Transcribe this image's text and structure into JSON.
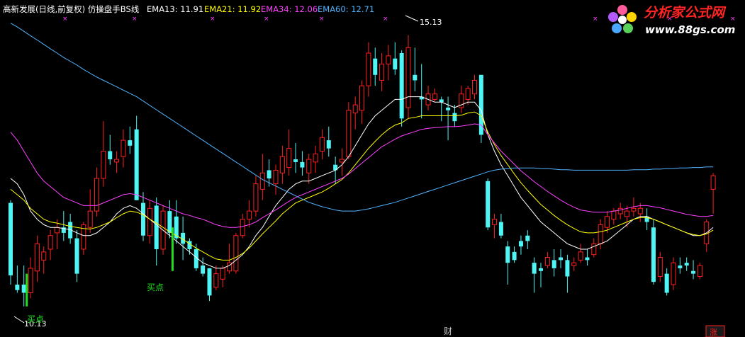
{
  "header": {
    "title": "高新发展(日线,前复权) 仿操盘手BS线",
    "indicators": [
      {
        "label": "EMA13: 11.91",
        "color": "#ffffff"
      },
      {
        "label": "EMA21: 11.92",
        "color": "#ffff00"
      },
      {
        "label": "EMA34: 12.06",
        "color": "#ff40ff"
      },
      {
        "label": "EMA60: 12.71",
        "color": "#4fb4ff"
      }
    ]
  },
  "logo": {
    "brand": "分析家公式网",
    "url_text": "www.88gs.com"
  },
  "annotations": {
    "high_price": "15.13",
    "low_price": "10.13",
    "buy_label_1": "买点",
    "buy_label_2": "买点",
    "bottom_marker": "财",
    "corner_badge": "涨"
  },
  "colors": {
    "background": "#000000",
    "up_candle": "#ff2020",
    "down_candle": "#4ff5f5",
    "buy_signal": "#20e020",
    "ema13": "#ffffff",
    "ema21": "#ffff00",
    "ema34": "#ff40ff",
    "ema60": "#4fb4ff"
  },
  "chart_data": {
    "type": "candlestick",
    "title": "高新发展(日线,前复权) 仿操盘手BS线",
    "y_range": [
      9.9,
      15.45
    ],
    "grid": false,
    "highest_price": 15.13,
    "lowest_price": 10.13,
    "candles": [
      [
        12.05,
        12.1,
        10.55,
        10.72
      ],
      [
        10.55,
        10.9,
        10.4,
        10.45
      ],
      [
        10.55,
        10.9,
        10.15,
        10.4
      ],
      [
        10.4,
        11.05,
        10.3,
        10.85
      ],
      [
        10.8,
        11.45,
        10.6,
        11.3
      ],
      [
        11.0,
        11.25,
        10.75,
        11.15
      ],
      [
        11.2,
        11.55,
        11.0,
        11.45
      ],
      [
        11.5,
        11.75,
        11.2,
        11.6
      ],
      [
        11.6,
        11.9,
        11.35,
        11.5
      ],
      [
        11.7,
        11.85,
        11.3,
        11.4
      ],
      [
        11.4,
        11.55,
        10.6,
        10.75
      ],
      [
        11.2,
        11.7,
        11.1,
        11.65
      ],
      [
        11.6,
        12.3,
        11.5,
        11.9
      ],
      [
        11.9,
        12.7,
        11.8,
        12.5
      ],
      [
        12.5,
        13.55,
        12.35,
        13.0
      ],
      [
        13.0,
        13.3,
        12.75,
        12.85
      ],
      [
        12.8,
        13.0,
        12.6,
        12.85
      ],
      [
        12.9,
        13.4,
        12.7,
        13.2
      ],
      [
        13.2,
        13.45,
        12.95,
        13.1
      ],
      [
        13.4,
        13.65,
        12.1,
        12.1
      ],
      [
        12.05,
        12.25,
        11.35,
        11.45
      ],
      [
        11.45,
        12.1,
        11.3,
        11.95
      ],
      [
        12.0,
        12.15,
        10.9,
        11.2
      ],
      [
        11.2,
        12.0,
        11.1,
        11.9
      ],
      [
        11.9,
        12.1,
        11.4,
        11.5
      ],
      [
        11.8,
        12.1,
        11.3,
        11.4
      ],
      [
        11.5,
        11.8,
        11.0,
        11.3
      ],
      [
        11.35,
        11.4,
        11.1,
        11.2
      ],
      [
        11.2,
        11.3,
        10.8,
        10.85
      ],
      [
        10.9,
        11.05,
        10.7,
        10.75
      ],
      [
        10.85,
        10.85,
        10.25,
        10.35
      ],
      [
        10.5,
        10.9,
        10.45,
        10.75
      ],
      [
        10.65,
        10.9,
        10.5,
        10.85
      ],
      [
        10.8,
        11.3,
        10.75,
        10.95
      ],
      [
        10.8,
        11.5,
        10.75,
        11.45
      ],
      [
        11.45,
        11.85,
        11.4,
        11.75
      ],
      [
        11.75,
        12.1,
        11.6,
        11.9
      ],
      [
        11.9,
        12.55,
        11.8,
        12.4
      ],
      [
        12.3,
        12.95,
        12.1,
        12.6
      ],
      [
        12.65,
        12.85,
        12.35,
        12.5
      ],
      [
        12.4,
        12.75,
        12.2,
        12.65
      ],
      [
        12.6,
        13.1,
        12.4,
        12.9
      ],
      [
        12.7,
        13.4,
        12.55,
        13.05
      ],
      [
        12.85,
        13.15,
        12.6,
        12.8
      ],
      [
        12.8,
        13.0,
        12.55,
        12.7
      ],
      [
        12.6,
        12.95,
        12.4,
        12.85
      ],
      [
        12.8,
        13.1,
        12.6,
        12.95
      ],
      [
        13.0,
        13.4,
        12.85,
        13.25
      ],
      [
        13.2,
        13.45,
        12.9,
        13.05
      ],
      [
        12.75,
        12.9,
        12.4,
        12.65
      ],
      [
        12.8,
        13.05,
        12.55,
        12.85
      ],
      [
        12.9,
        13.9,
        12.85,
        13.75
      ],
      [
        13.7,
        14.0,
        13.4,
        13.85
      ],
      [
        13.75,
        14.3,
        13.5,
        14.2
      ],
      [
        14.2,
        15.0,
        14.0,
        14.8
      ],
      [
        14.7,
        14.9,
        14.2,
        14.4
      ],
      [
        14.3,
        14.8,
        14.1,
        14.6
      ],
      [
        14.6,
        14.95,
        14.3,
        14.75
      ],
      [
        14.7,
        15.0,
        14.4,
        14.5
      ],
      [
        14.8,
        14.85,
        13.45,
        13.6
      ],
      [
        13.8,
        15.13,
        13.6,
        14.9
      ],
      [
        14.4,
        14.9,
        14.1,
        14.3
      ],
      [
        14.0,
        14.6,
        13.6,
        13.95
      ],
      [
        13.85,
        14.2,
        13.75,
        14.05
      ],
      [
        13.95,
        14.15,
        13.9,
        14.05
      ],
      [
        13.95,
        14.0,
        13.55,
        13.9
      ],
      [
        13.8,
        14.0,
        13.2,
        13.75
      ],
      [
        13.7,
        13.85,
        13.45,
        13.55
      ],
      [
        13.8,
        14.2,
        13.7,
        14.05
      ],
      [
        13.95,
        14.2,
        13.85,
        14.15
      ],
      [
        14.05,
        14.4,
        13.95,
        14.3
      ],
      [
        14.4,
        14.4,
        13.15,
        13.3
      ],
      [
        12.45,
        12.5,
        11.55,
        11.6
      ],
      [
        11.65,
        11.85,
        11.4,
        11.75
      ],
      [
        11.7,
        11.85,
        11.4,
        11.45
      ],
      [
        11.25,
        11.35,
        10.55,
        10.95
      ],
      [
        11.15,
        11.25,
        10.95,
        11.0
      ],
      [
        11.35,
        11.45,
        11.1,
        11.25
      ],
      [
        11.45,
        11.55,
        11.2,
        11.35
      ],
      [
        10.95,
        11.05,
        10.4,
        10.75
      ],
      [
        10.85,
        10.95,
        10.5,
        10.8
      ],
      [
        10.9,
        11.15,
        10.85,
        11.05
      ],
      [
        11.0,
        11.2,
        10.7,
        10.85
      ],
      [
        11.05,
        11.2,
        10.85,
        11.0
      ],
      [
        11.0,
        11.1,
        10.4,
        10.7
      ],
      [
        10.9,
        11.05,
        10.8,
        10.95
      ],
      [
        11.0,
        11.3,
        10.95,
        11.15
      ],
      [
        11.05,
        11.2,
        10.9,
        11.0
      ],
      [
        11.1,
        11.4,
        11.05,
        11.3
      ],
      [
        11.3,
        11.75,
        11.2,
        11.65
      ],
      [
        11.6,
        11.9,
        11.5,
        11.8
      ],
      [
        11.75,
        11.95,
        11.65,
        11.9
      ],
      [
        11.85,
        12.05,
        11.75,
        11.95
      ],
      [
        11.8,
        12.0,
        11.6,
        11.9
      ],
      [
        11.9,
        12.15,
        11.8,
        11.95
      ],
      [
        11.85,
        12.05,
        11.7,
        11.95
      ],
      [
        11.8,
        11.95,
        11.55,
        11.7
      ],
      [
        11.6,
        11.75,
        10.55,
        10.6
      ],
      [
        10.7,
        11.15,
        10.6,
        11.05
      ],
      [
        10.75,
        10.85,
        10.35,
        10.4
      ],
      [
        10.55,
        11.05,
        10.45,
        10.95
      ],
      [
        10.9,
        11.05,
        10.75,
        10.85
      ],
      [
        10.95,
        11.05,
        10.8,
        10.9
      ],
      [
        10.8,
        11.0,
        10.65,
        10.75
      ],
      [
        10.7,
        10.95,
        10.65,
        10.9
      ],
      [
        11.3,
        11.75,
        11.15,
        11.7
      ],
      [
        12.3,
        12.6,
        11.85,
        12.55
      ]
    ],
    "series": [
      {
        "name": "EMA13",
        "values": [
          12.5,
          12.4,
          12.2,
          11.9,
          11.75,
          11.65,
          11.6,
          11.6,
          11.58,
          11.56,
          11.5,
          11.45,
          11.45,
          11.5,
          11.6,
          11.7,
          11.85,
          11.95,
          12.0,
          11.95,
          11.85,
          11.75,
          11.65,
          11.55,
          11.45,
          11.35,
          11.25,
          11.15,
          11.05,
          10.95,
          10.9,
          10.85,
          10.85,
          10.9,
          11.0,
          11.1,
          11.25,
          11.45,
          11.6,
          11.8,
          12.0,
          12.15,
          12.3,
          12.4,
          12.45,
          12.45,
          12.5,
          12.55,
          12.6,
          12.65,
          12.75,
          12.9,
          13.1,
          13.3,
          13.5,
          13.65,
          13.75,
          13.85,
          13.95,
          13.95,
          14.0,
          14.0,
          14.0,
          13.95,
          13.9,
          13.9,
          13.85,
          13.8,
          13.85,
          13.9,
          13.9,
          13.75,
          13.3,
          13.0,
          12.75,
          12.55,
          12.35,
          12.15,
          12.0,
          11.85,
          11.7,
          11.6,
          11.5,
          11.4,
          11.3,
          11.25,
          11.2,
          11.2,
          11.25,
          11.3,
          11.35,
          11.45,
          11.55,
          11.65,
          11.75,
          11.8,
          11.8,
          11.75,
          11.7,
          11.65,
          11.6,
          11.55,
          11.5,
          11.45,
          11.45,
          11.5,
          11.6
        ]
      },
      {
        "name": "EMA21",
        "values": [
          12.3,
          12.2,
          12.1,
          11.95,
          11.85,
          11.75,
          11.7,
          11.68,
          11.65,
          11.62,
          11.6,
          11.58,
          11.57,
          11.6,
          11.65,
          11.7,
          11.78,
          11.85,
          11.9,
          11.88,
          11.83,
          11.75,
          11.68,
          11.6,
          11.52,
          11.45,
          11.38,
          11.3,
          11.22,
          11.15,
          11.08,
          11.02,
          11.0,
          11.0,
          11.05,
          11.12,
          11.22,
          11.35,
          11.48,
          11.6,
          11.72,
          11.85,
          11.95,
          12.05,
          12.1,
          12.15,
          12.2,
          12.25,
          12.32,
          12.4,
          12.48,
          12.6,
          12.75,
          12.9,
          13.05,
          13.18,
          13.3,
          13.4,
          13.48,
          13.52,
          13.6,
          13.62,
          13.65,
          13.65,
          13.65,
          13.65,
          13.65,
          13.65,
          13.66,
          13.7,
          13.72,
          13.65,
          13.35,
          13.12,
          12.92,
          12.75,
          12.58,
          12.42,
          12.28,
          12.15,
          12.02,
          11.92,
          11.82,
          11.73,
          11.65,
          11.58,
          11.52,
          11.5,
          11.5,
          11.52,
          11.55,
          11.6,
          11.65,
          11.7,
          11.75,
          11.78,
          11.78,
          11.75,
          11.7,
          11.65,
          11.6,
          11.55,
          11.5,
          11.47,
          11.45,
          11.48,
          11.55
        ]
      },
      {
        "name": "EMA34",
        "values": [
          13.35,
          13.2,
          13.0,
          12.8,
          12.6,
          12.45,
          12.35,
          12.25,
          12.15,
          12.1,
          12.05,
          12.0,
          12.0,
          12.0,
          12.05,
          12.1,
          12.15,
          12.2,
          12.22,
          12.2,
          12.15,
          12.1,
          12.05,
          12.0,
          11.95,
          11.9,
          11.85,
          11.82,
          11.78,
          11.75,
          11.7,
          11.65,
          11.62,
          11.6,
          11.6,
          11.62,
          11.65,
          11.7,
          11.78,
          11.85,
          11.92,
          12.0,
          12.08,
          12.15,
          12.2,
          12.25,
          12.3,
          12.35,
          12.4,
          12.45,
          12.5,
          12.58,
          12.68,
          12.78,
          12.88,
          12.98,
          13.08,
          13.15,
          13.22,
          13.28,
          13.32,
          13.36,
          13.4,
          13.42,
          13.43,
          13.44,
          13.45,
          13.45,
          13.46,
          13.48,
          13.5,
          13.48,
          13.3,
          13.15,
          13.0,
          12.88,
          12.76,
          12.64,
          12.54,
          12.44,
          12.35,
          12.26,
          12.18,
          12.1,
          12.03,
          11.97,
          11.92,
          11.9,
          11.88,
          11.88,
          11.88,
          11.9,
          11.92,
          11.95,
          11.98,
          12.0,
          12.0,
          11.98,
          11.96,
          11.93,
          11.9,
          11.87,
          11.84,
          11.82,
          11.8,
          11.8,
          11.82
        ]
      },
      {
        "name": "EMA60",
        "values": [
          15.35,
          15.28,
          15.2,
          15.12,
          15.04,
          14.96,
          14.88,
          14.8,
          14.72,
          14.65,
          14.58,
          14.5,
          14.43,
          14.36,
          14.3,
          14.24,
          14.18,
          14.12,
          14.06,
          14.0,
          13.92,
          13.84,
          13.76,
          13.68,
          13.6,
          13.52,
          13.44,
          13.36,
          13.28,
          13.2,
          13.12,
          13.04,
          12.96,
          12.88,
          12.8,
          12.72,
          12.64,
          12.56,
          12.48,
          12.42,
          12.36,
          12.3,
          12.24,
          12.18,
          12.12,
          12.06,
          12.02,
          11.98,
          11.95,
          11.92,
          11.9,
          11.9,
          11.9,
          11.92,
          11.94,
          11.97,
          12.0,
          12.03,
          12.06,
          12.1,
          12.14,
          12.18,
          12.22,
          12.26,
          12.3,
          12.34,
          12.38,
          12.42,
          12.46,
          12.5,
          12.54,
          12.58,
          12.62,
          12.65,
          12.67,
          12.68,
          12.69,
          12.69,
          12.69,
          12.69,
          12.68,
          12.68,
          12.67,
          12.66,
          12.66,
          12.65,
          12.65,
          12.65,
          12.65,
          12.65,
          12.65,
          12.65,
          12.65,
          12.65,
          12.66,
          12.66,
          12.66,
          12.67,
          12.67,
          12.68,
          12.68,
          12.69,
          12.69,
          12.7,
          12.7,
          12.71,
          12.71
        ]
      }
    ],
    "buy_signals": [
      {
        "index": 2,
        "label": "买点",
        "from": 10.15,
        "to": 10.75
      },
      {
        "index": 24,
        "label": "买点",
        "from": 10.8,
        "to": 11.6
      }
    ]
  }
}
